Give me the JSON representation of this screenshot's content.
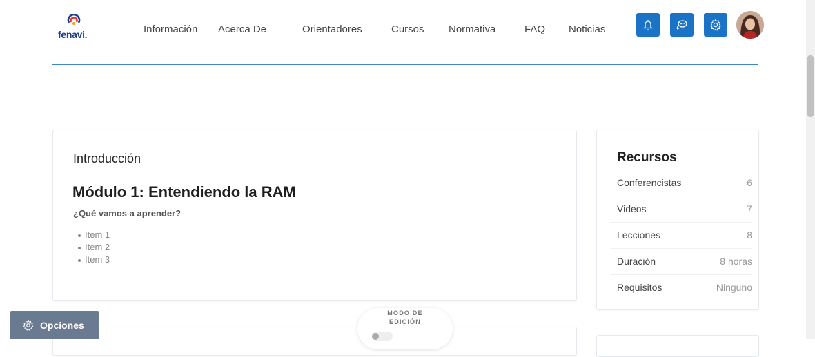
{
  "brand": {
    "logo_text": "fenavi",
    "logo_dot": "."
  },
  "nav": {
    "items": [
      {
        "label": "Información"
      },
      {
        "label": "Acerca De"
      },
      {
        "label": "Orientadores"
      },
      {
        "label": "Cursos"
      },
      {
        "label": "Normativa"
      },
      {
        "label": "FAQ"
      },
      {
        "label": "Noticias"
      }
    ]
  },
  "header_icons": [
    {
      "name": "notification-icon"
    },
    {
      "name": "chat-icon"
    },
    {
      "name": "gear-icon"
    }
  ],
  "colors": {
    "accent": "#1a73c7",
    "header_line": "#3f86c6",
    "options_bg": "#6a7a91"
  },
  "main": {
    "heading": "Introducción",
    "module_title": "Módulo 1: Entendiendo la RAM",
    "learn_label": "¿Qué vamos a aprender?",
    "items": [
      "Item 1",
      "Item 2",
      "Item 3"
    ]
  },
  "resources": {
    "title": "Recursos",
    "rows": [
      {
        "label": "Conferencistas",
        "value": "6"
      },
      {
        "label": "Videos",
        "value": "7"
      },
      {
        "label": "Lecciones",
        "value": "8"
      },
      {
        "label": "Duración",
        "value": "8 horas"
      },
      {
        "label": "Requisitos",
        "value": "Ninguno"
      }
    ]
  },
  "options_button": {
    "label": "Opciones"
  },
  "edit_mode": {
    "line1": "MODO DE",
    "line2": "EDICIÓN",
    "enabled": false
  }
}
